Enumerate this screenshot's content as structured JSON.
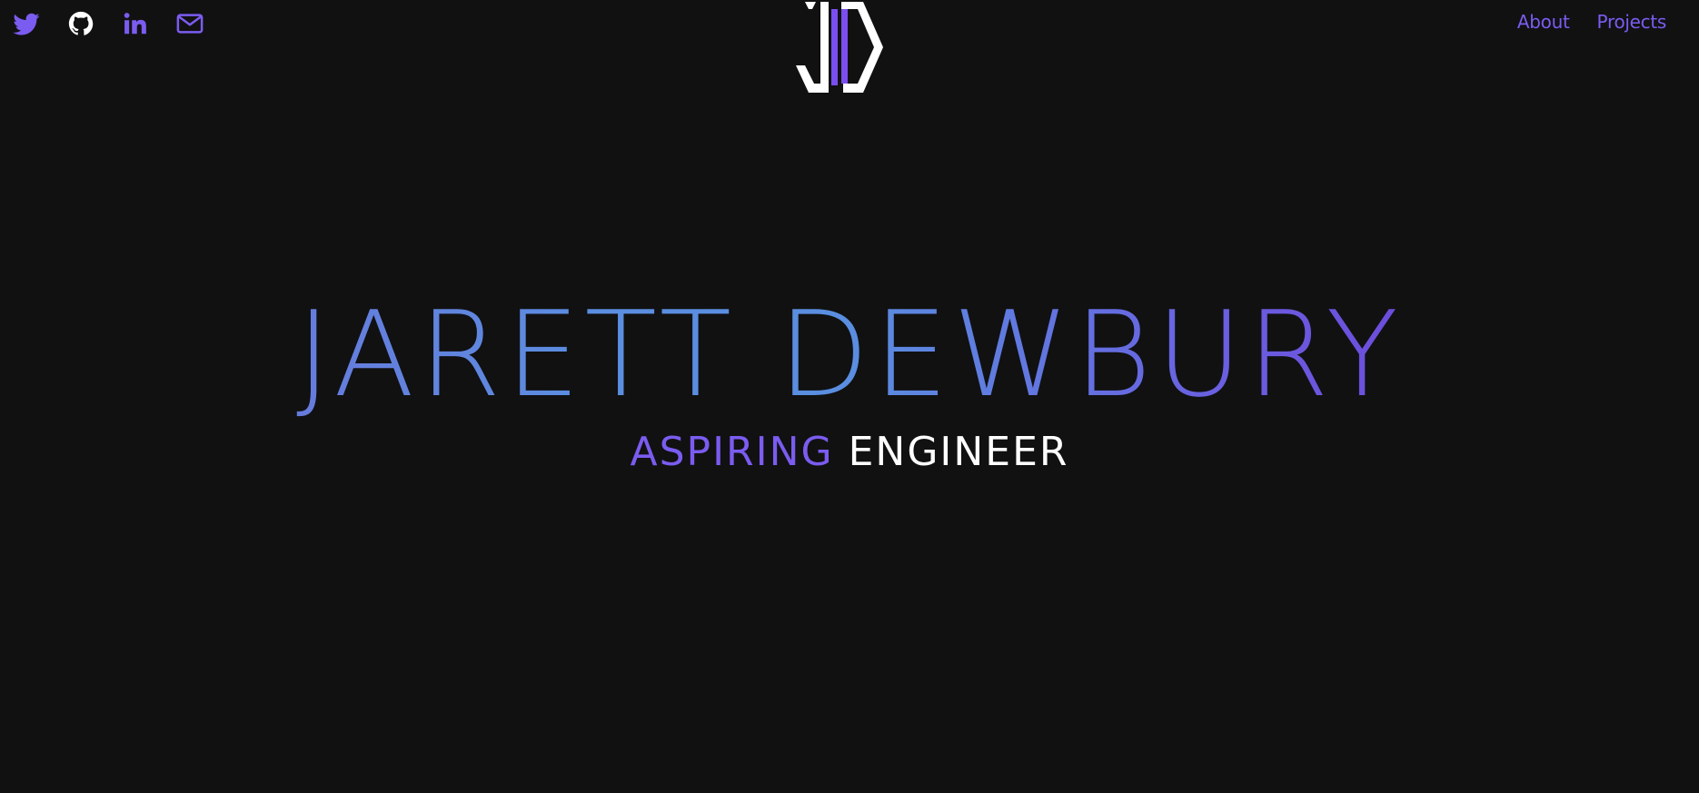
{
  "colors": {
    "background": "#111112",
    "accent": "#7b5cf0",
    "logo_white": "#ffffff",
    "logo_purple": "#7b4ef0"
  },
  "socials": [
    {
      "icon": "twitter-icon"
    },
    {
      "icon": "github-icon"
    },
    {
      "icon": "linkedin-icon"
    },
    {
      "icon": "mail-icon"
    }
  ],
  "logo": {
    "icon": "jd-hexagon-logo"
  },
  "nav": {
    "about_label": "About",
    "projects_label": "Projects"
  },
  "hero": {
    "name": "JARETT DEWBURY",
    "subtitle_accent": "ASPIRING",
    "subtitle_rest": "ENGINEER"
  }
}
